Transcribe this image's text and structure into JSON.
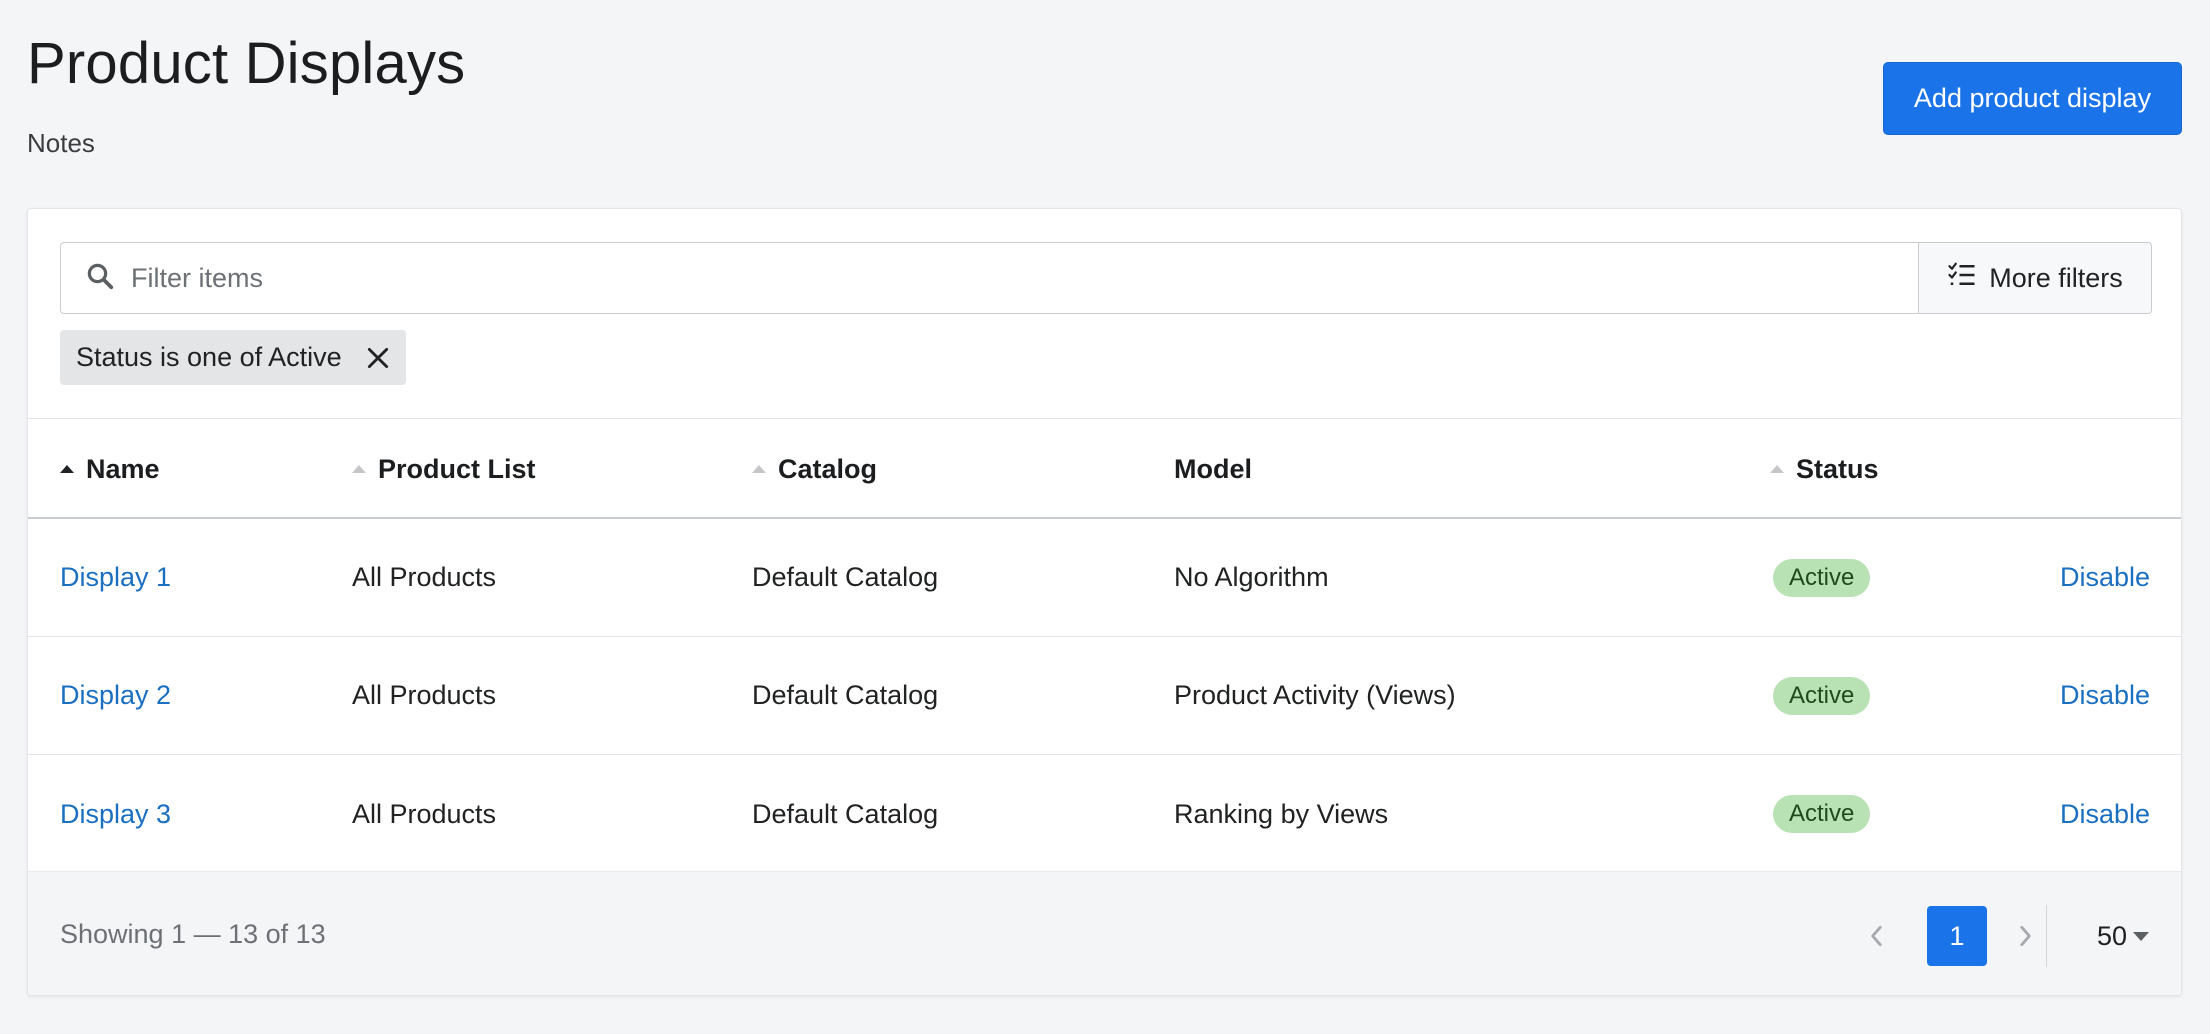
{
  "header": {
    "title": "Product Displays",
    "subtitle": "Notes",
    "add_button_label": "Add product display"
  },
  "filters": {
    "search_placeholder": "Filter items",
    "more_filters_label": "More filters",
    "active_chip": "Status is one of Active"
  },
  "table": {
    "columns": [
      {
        "label": "Name",
        "sortable": true,
        "sorted": true
      },
      {
        "label": "Product List",
        "sortable": true,
        "sorted": false
      },
      {
        "label": "Catalog",
        "sortable": true,
        "sorted": false
      },
      {
        "label": "Model",
        "sortable": false,
        "sorted": false
      },
      {
        "label": "Status",
        "sortable": true,
        "sorted": false
      }
    ],
    "rows": [
      {
        "name": "Display 1",
        "product_list": "All Products",
        "catalog": "Default Catalog",
        "model": "No Algorithm",
        "status": "Active",
        "action": "Disable"
      },
      {
        "name": "Display 2",
        "product_list": "All Products",
        "catalog": "Default Catalog",
        "model": "Product Activity (Views)",
        "status": "Active",
        "action": "Disable"
      },
      {
        "name": "Display 3",
        "product_list": "All Products",
        "catalog": "Default Catalog",
        "model": "Ranking by Views",
        "status": "Active",
        "action": "Disable"
      }
    ]
  },
  "footer": {
    "showing": "Showing 1 — 13 of 13",
    "current_page": "1",
    "per_page": "50"
  },
  "colors": {
    "primary": "#1a73e8",
    "link": "#1a6fc0",
    "active_badge": "#b8e2b3"
  }
}
